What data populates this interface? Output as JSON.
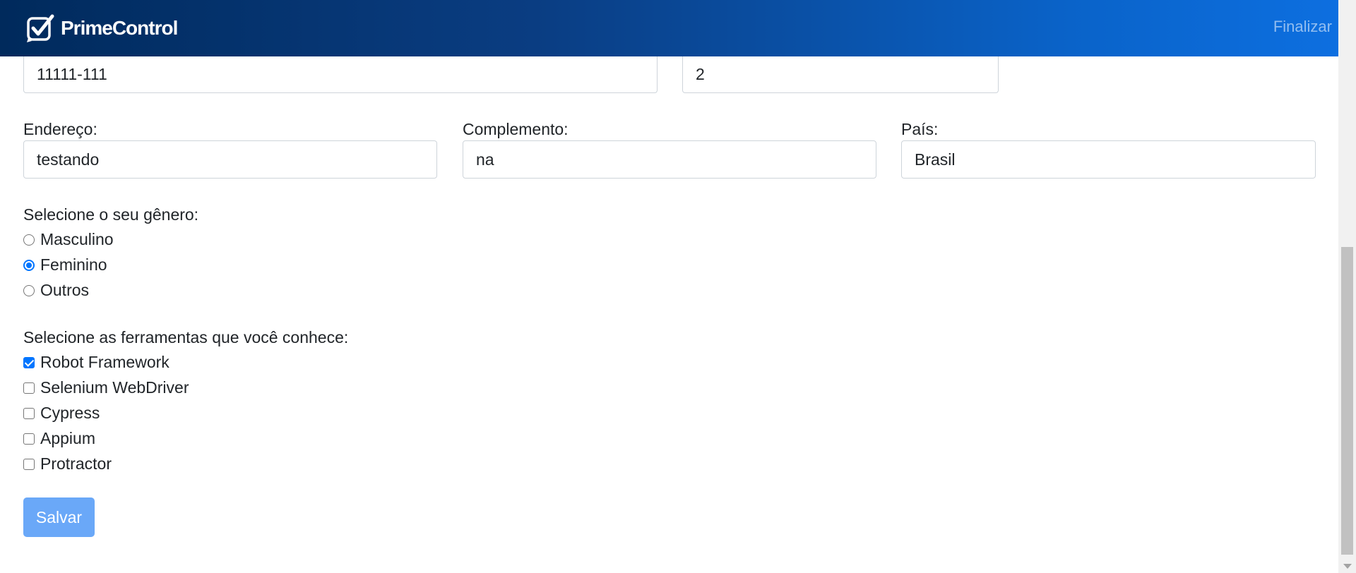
{
  "navbar": {
    "brand": "PrimeControl",
    "finalize_link": "Finalizar"
  },
  "form": {
    "cep_value": "11111-111",
    "number_value": "2",
    "address": {
      "label": "Endereço:",
      "value": "testando"
    },
    "complement": {
      "label": "Complemento:",
      "value": "na"
    },
    "country": {
      "label": "País:",
      "value": "Brasil"
    },
    "gender": {
      "label": "Selecione o seu gênero:",
      "options": [
        {
          "label": "Masculino",
          "selected": false
        },
        {
          "label": "Feminino",
          "selected": true
        },
        {
          "label": "Outros",
          "selected": false
        }
      ]
    },
    "tools": {
      "label": "Selecione as ferramentas que você conhece:",
      "options": [
        {
          "label": "Robot Framework",
          "checked": true
        },
        {
          "label": "Selenium WebDriver",
          "checked": false
        },
        {
          "label": "Cypress",
          "checked": false
        },
        {
          "label": "Appium",
          "checked": false
        },
        {
          "label": "Protractor",
          "checked": false
        }
      ]
    },
    "save_label": "Salvar"
  },
  "colors": {
    "primary": "#0075ff",
    "button": "#6aa8f8",
    "navbar_start": "#002a5c",
    "navbar_end": "#0d6fe0"
  }
}
